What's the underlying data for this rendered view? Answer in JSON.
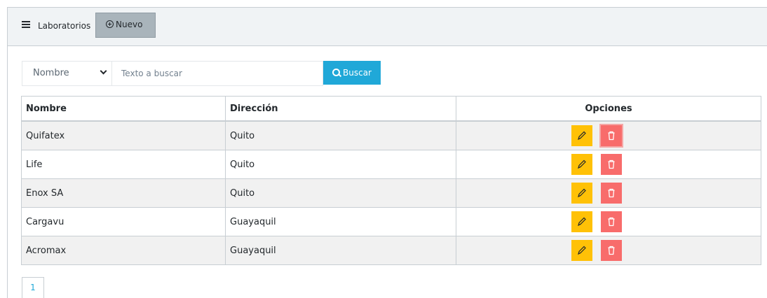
{
  "header": {
    "title": "Laboratorios",
    "new_button": "Nuevo"
  },
  "search": {
    "field_selected": "Nombre",
    "placeholder": "Texto a buscar",
    "button": "Buscar"
  },
  "table": {
    "headers": {
      "name": "Nombre",
      "address": "Dirección",
      "options": "Opciones"
    },
    "rows": [
      {
        "name": "Quifatex",
        "address": "Quito"
      },
      {
        "name": "Life",
        "address": "Quito"
      },
      {
        "name": "Enox SA",
        "address": "Quito"
      },
      {
        "name": "Cargavu",
        "address": "Guayaquil"
      },
      {
        "name": "Acromax",
        "address": "Guayaquil"
      }
    ]
  },
  "pagination": {
    "current_page": "1"
  },
  "icons": {
    "menu": "hamburger-icon",
    "new": "plus-circle-icon",
    "search": "search-icon",
    "edit": "pencil-icon",
    "delete": "trash-icon"
  },
  "colors": {
    "primary": "#20a8d8",
    "warning": "#ffc107",
    "danger": "#f86c6b",
    "header_bg": "#f0f3f5",
    "new_button_bg": "#a9b4bb"
  }
}
